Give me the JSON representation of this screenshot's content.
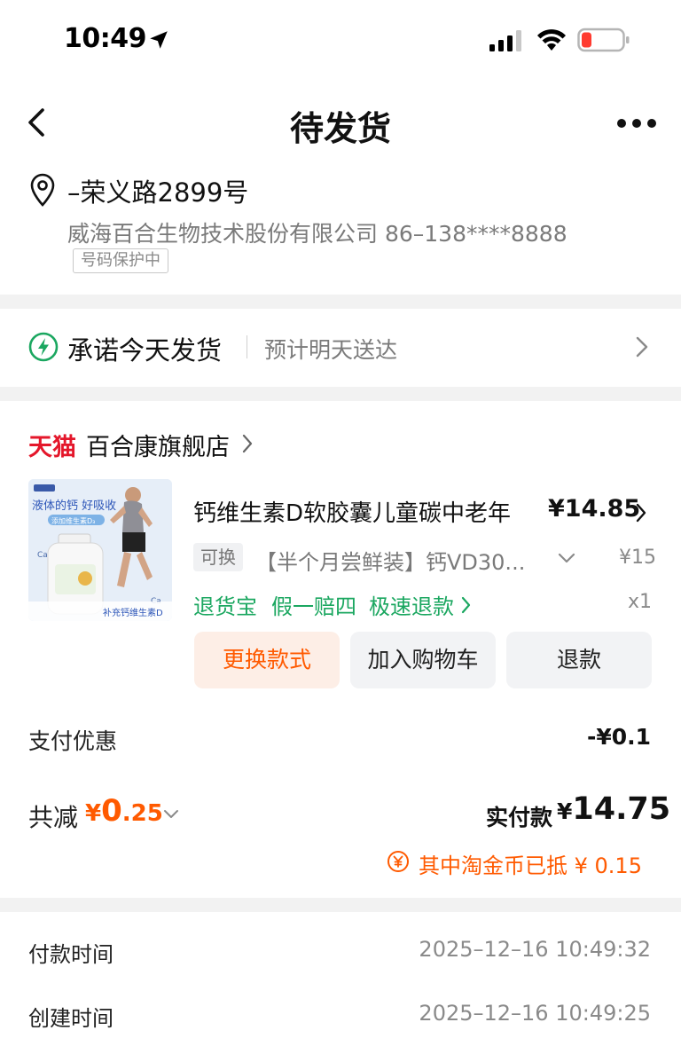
{
  "status_bar": {
    "time": "10:49"
  },
  "nav": {
    "title": "待发货"
  },
  "address": {
    "line1": "–荣义路2899号",
    "line2": "威海百合生物技术股份有限公司 86–138****8888",
    "badge": "号码保护中"
  },
  "shipping": {
    "title": "承诺今天发货",
    "subtitle": "预计明天送达"
  },
  "store": {
    "logo": "天猫",
    "name": "百合康旗舰店"
  },
  "product": {
    "image_text": "液体的钙 好吸收",
    "image_sub": "添加维生素D₃",
    "image_bottom": "补充钙维生素D",
    "title": "钙维生素D软胶囊儿童碳中老年",
    "price": "¥14.85",
    "tag": "可换",
    "variant": "【半个月尝鲜装】钙VD30...",
    "variant_price": "¥15",
    "services": [
      "退货宝",
      "假一赔四",
      "极速退款"
    ],
    "qty": "x1"
  },
  "buttons": {
    "change": "更换款式",
    "cart": "加入购物车",
    "refund": "退款"
  },
  "totals": {
    "discount_label": "支付优惠",
    "discount_value": "-¥0.1",
    "saved_label": "共减",
    "saved_yen": "¥",
    "saved_int": "0",
    "saved_dec": ".25",
    "paid_label": "实付款",
    "paid_yen": "¥",
    "paid_value": "14.75",
    "coin_text": "其中淘金币已抵 ¥ 0.15"
  },
  "info": [
    {
      "label": "付款时间",
      "value": "2025–12–16 10:49:32"
    },
    {
      "label": "创建时间",
      "value": "2025–12–16 10:49:25"
    }
  ],
  "colors": {
    "accent": "#ff5a00",
    "green": "#1ba760",
    "tmall_red": "#e4172b"
  }
}
